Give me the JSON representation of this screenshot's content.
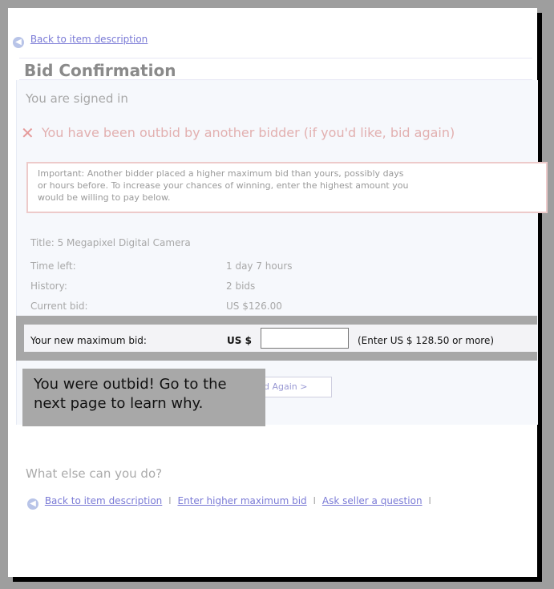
{
  "nav": {
    "back_link": "Back to item description"
  },
  "header": {
    "title": "Bid Confirmation"
  },
  "status": {
    "signed_in": "You are signed in",
    "outbid_message": "You have been outbid by another bidder (if you'd like, bid again)"
  },
  "important": {
    "line1": "Important: Another bidder placed a higher maximum bid than yours, possibly days",
    "line2": "or hours before. To increase your chances of winning, enter the highest amount you",
    "line3": "would be willing to pay below."
  },
  "item": {
    "title": "Title: 5 Megapixel Digital Camera",
    "time_left_label": "Time left:",
    "time_left_value": "1 day 7 hours",
    "history_label": "History:",
    "history_value": "2 bids",
    "current_bid_label": "Current bid:",
    "current_bid_value": "US $126.00"
  },
  "bid_form": {
    "label": "Your new maximum bid:",
    "currency": "US $",
    "input_value": "",
    "enter_note": "(Enter US $ 128.50 or more)",
    "submit_label": "d Again >"
  },
  "tooltip": {
    "line1": "You were outbid! Go to the",
    "line2": "next page to learn why."
  },
  "footer": {
    "heading": "What else can you do?",
    "links": [
      "Back to item description",
      "Enter higher maximum bid",
      "Ask seller a question"
    ],
    "separator": "I"
  }
}
